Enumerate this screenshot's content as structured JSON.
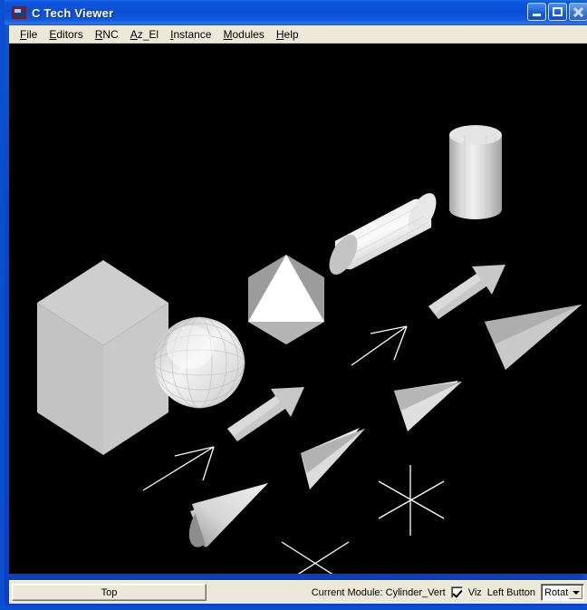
{
  "window": {
    "title": "C Tech Viewer",
    "icon": "app-icon",
    "controls": [
      {
        "name": "minimize",
        "glyph": "minimize-icon"
      },
      {
        "name": "maximize",
        "glyph": "maximize-icon"
      },
      {
        "name": "close",
        "glyph": "close-icon"
      }
    ]
  },
  "menubar": {
    "items": [
      {
        "label": "File",
        "accel": "F"
      },
      {
        "label": "Editors",
        "accel": "E"
      },
      {
        "label": "RNC",
        "accel": "R"
      },
      {
        "label": "Az_El",
        "accel": "A"
      },
      {
        "label": "Instance",
        "accel": "I"
      },
      {
        "label": "Modules",
        "accel": "M"
      },
      {
        "label": "Help",
        "accel": "H"
      }
    ]
  },
  "viewport": {
    "background": "#000000",
    "objects": [
      {
        "name": "cube",
        "label": "Cube"
      },
      {
        "name": "sphere",
        "label": "Sphere"
      },
      {
        "name": "octahedron",
        "label": "Octahedron"
      },
      {
        "name": "cylinder-angled",
        "label": "Cylinder_Horiz"
      },
      {
        "name": "cylinder-vertical",
        "label": "Cylinder_Vert"
      },
      {
        "name": "cone-lower-left",
        "label": "Cone"
      },
      {
        "name": "cone-middle",
        "label": "Cone"
      },
      {
        "name": "cone-upper",
        "label": "Cone"
      },
      {
        "name": "cone-right",
        "label": "Cone"
      },
      {
        "name": "arrow-solid-lower",
        "label": "Arrow"
      },
      {
        "name": "arrow-solid-upper",
        "label": "Arrow"
      },
      {
        "name": "arrow-line-lower",
        "label": "Line Arrow"
      },
      {
        "name": "arrow-line-upper",
        "label": "Line Arrow"
      },
      {
        "name": "star-marker",
        "label": "Star Marker"
      },
      {
        "name": "cross-marker",
        "label": "Cross Marker"
      }
    ]
  },
  "statusbar": {
    "top_button_label": "Top",
    "module_label": "Current Module: Cylinder_Vert",
    "viz_label": "Viz",
    "viz_checked": true,
    "left_button_label": "Left Button",
    "mouse_mode": "Rotate"
  },
  "colors": {
    "title_bar": "#0a4ed6",
    "frame": "#0b4fd0",
    "chrome": "#ece9d8",
    "viewport_bg": "#000000",
    "surface_light": "#f2f2f2",
    "surface_mid": "#c8c8c8",
    "surface_dark": "#8a8a8a",
    "wire": "#ffffff"
  }
}
